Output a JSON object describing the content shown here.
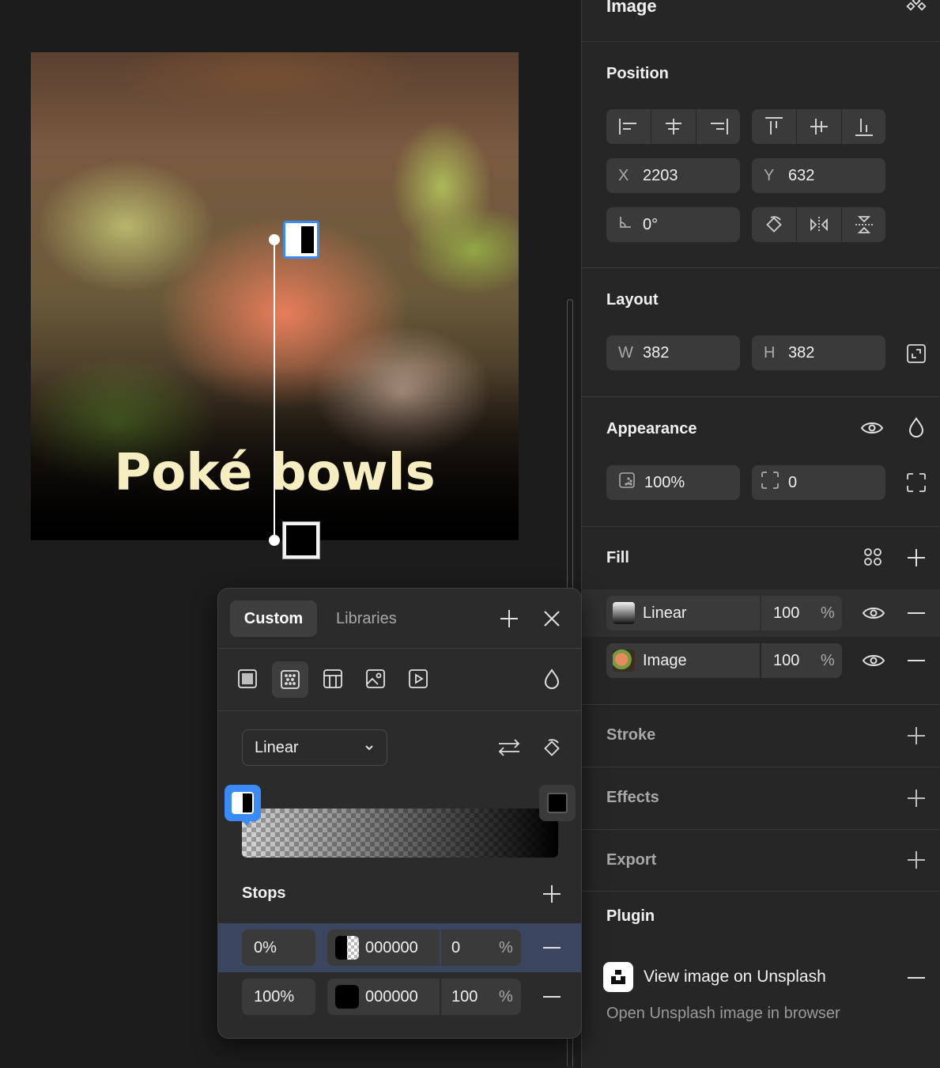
{
  "canvas": {
    "photo_title": "Poké bowls"
  },
  "panel": {
    "header_title": "Image",
    "position": {
      "title": "Position",
      "x_label": "X",
      "x_value": "2203",
      "y_label": "Y",
      "y_value": "632",
      "rotation_value": "0°"
    },
    "layout": {
      "title": "Layout",
      "w_label": "W",
      "w_value": "382",
      "h_label": "H",
      "h_value": "382"
    },
    "appearance": {
      "title": "Appearance",
      "opacity_value": "100%",
      "radius_value": "0"
    },
    "fill": {
      "title": "Fill",
      "layers": [
        {
          "name": "Linear",
          "opacity": "100",
          "unit": "%"
        },
        {
          "name": "Image",
          "opacity": "100",
          "unit": "%"
        }
      ]
    },
    "stroke_title": "Stroke",
    "effects_title": "Effects",
    "export_title": "Export",
    "plugin": {
      "title": "Plugin",
      "item_label": "View image on Unsplash",
      "item_desc": "Open Unsplash image in browser"
    }
  },
  "picker": {
    "tabs": [
      "Custom",
      "Libraries"
    ],
    "gradient_type": "Linear",
    "stops_title": "Stops",
    "stops": [
      {
        "position": "0%",
        "hex": "000000",
        "opacity": "0",
        "unit": "%"
      },
      {
        "position": "100%",
        "hex": "000000",
        "opacity": "100",
        "unit": "%"
      }
    ]
  },
  "colors": {
    "accent": "#3a8bf5",
    "panel_bg": "#262626",
    "field_bg": "#3a3a3a",
    "selected_row": "#3a4560"
  }
}
